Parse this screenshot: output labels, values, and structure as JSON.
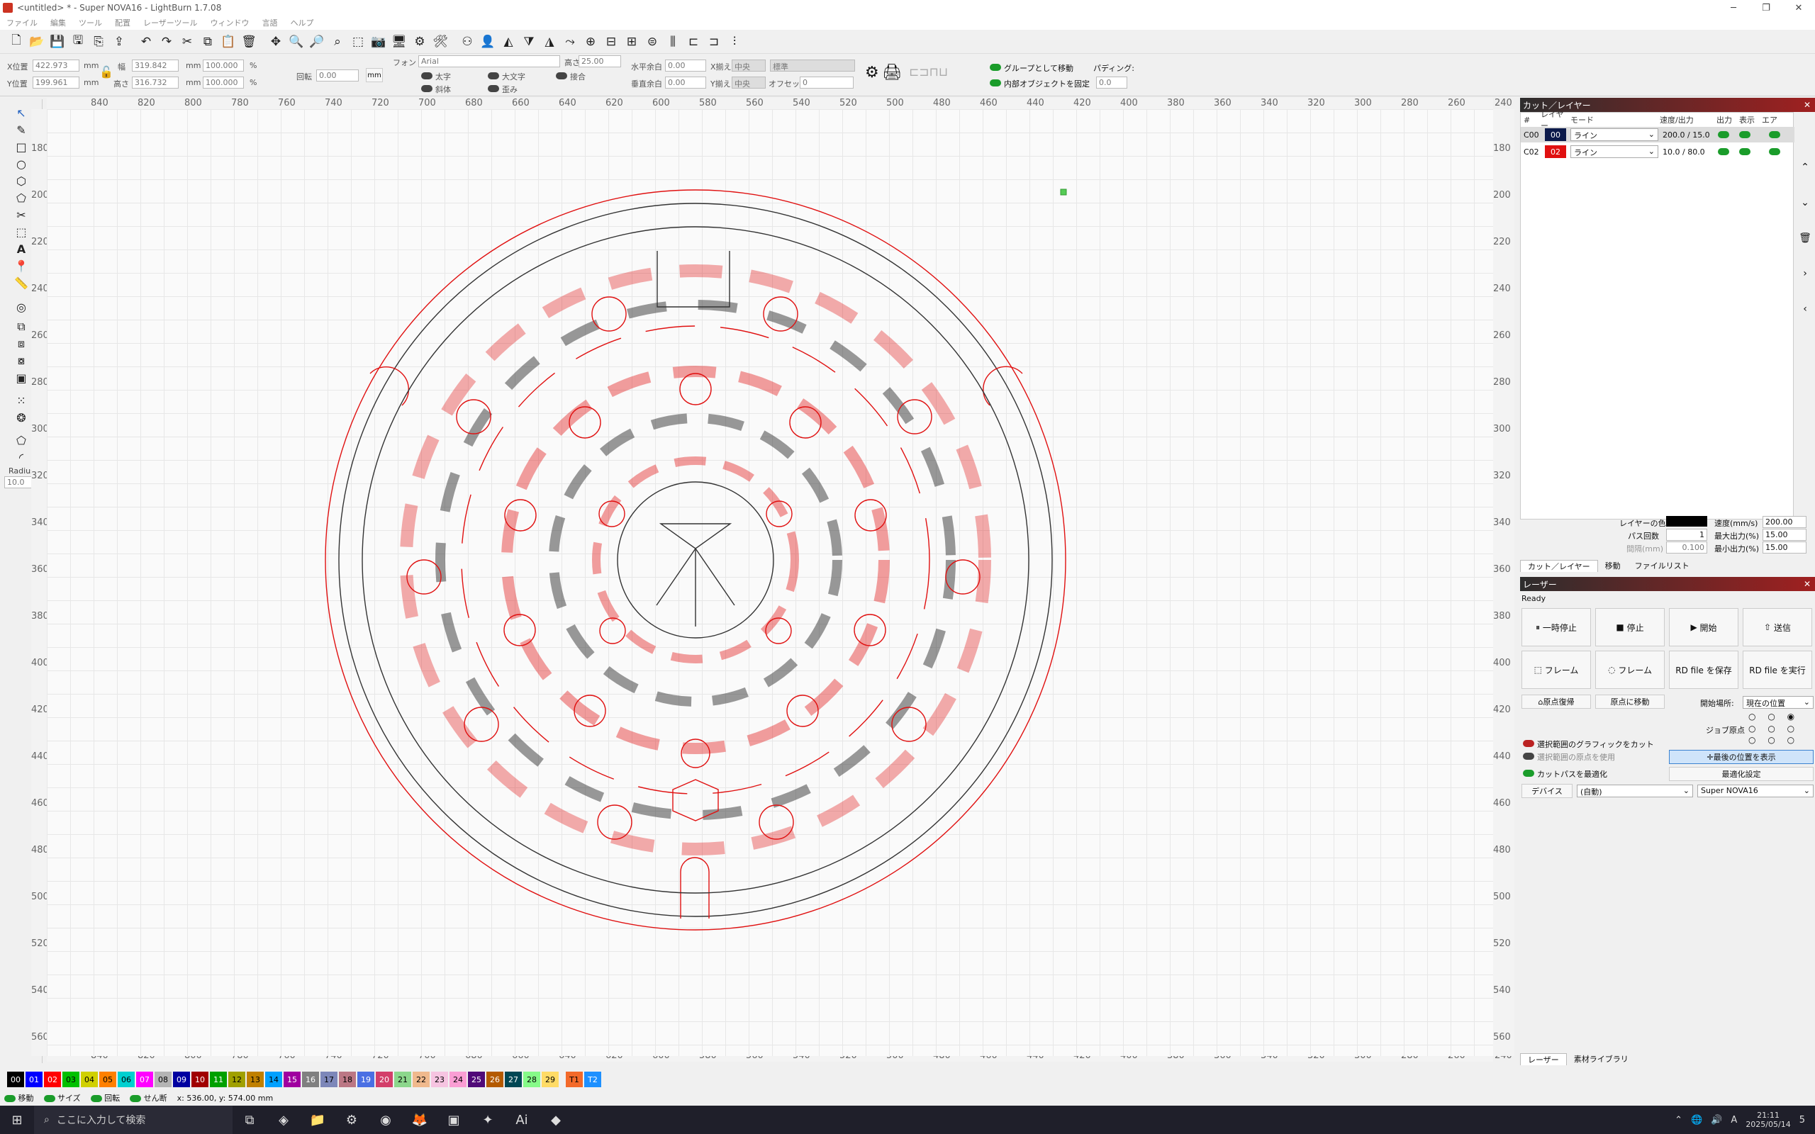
{
  "window": {
    "title": "<untitled> * - Super NOVA16 - LightBurn 1.7.08",
    "minimize": "─",
    "maximize": "❐",
    "close": "✕"
  },
  "menu": [
    "ファイル",
    "編集",
    "ツール",
    "配置",
    "レーザーツール",
    "ウィンドウ",
    "言語",
    "ヘルプ"
  ],
  "props": {
    "x_label": "X位置",
    "x_value": "422.973",
    "y_label": "Y位置",
    "y_value": "199.961",
    "w_label": "幅",
    "w_value": "319.842",
    "h_label": "高さ",
    "h_value": "316.732",
    "mm": "mm",
    "pct_w": "100.000",
    "pct_h": "100.000",
    "pct": "%",
    "rot_label": "回転",
    "rot_value": "0.00",
    "mm_btn": "mm"
  },
  "font": {
    "label": "フォント",
    "name": "Arial",
    "height_label": "高さ",
    "height": "25.00",
    "bold": "太字",
    "caps": "大文字",
    "join": "接合",
    "italic": "斜体",
    "distort": "歪み",
    "hspace_label": "水平余白",
    "hspace": "0.00",
    "vspace_label": "垂直余白",
    "vspace": "0.00",
    "xalign_label": "X揃え",
    "xalign": "中央",
    "yalign_label": "Y揃え",
    "yalign": "中央",
    "style": "標準",
    "offset_label": "オフセット",
    "offset": "0"
  },
  "group": {
    "move_as_group": "グループとして移動",
    "lock_inner": "内部オブジェクトを固定",
    "padding_label": "パディング:",
    "padding": "0.0"
  },
  "ruler": {
    "top": [
      "840",
      "820",
      "800",
      "780",
      "760",
      "740",
      "720",
      "700",
      "680",
      "660",
      "640",
      "620",
      "600",
      "580",
      "560",
      "540",
      "520",
      "500",
      "480",
      "460",
      "440",
      "420",
      "400",
      "380",
      "360",
      "340",
      "320",
      "300",
      "280",
      "260",
      "240"
    ],
    "left": [
      "180",
      "200",
      "220",
      "240",
      "260",
      "280",
      "300",
      "320",
      "340",
      "360",
      "380",
      "400",
      "420",
      "440",
      "460",
      "480",
      "500",
      "520",
      "540",
      "560"
    ]
  },
  "cut_panel": {
    "title": "カット／レイヤー",
    "headers": [
      "#",
      "レイヤー",
      "モード",
      "速度/出力",
      "出力",
      "表示",
      "エア"
    ],
    "rows": [
      {
        "id": "C00",
        "layer": "00",
        "mode": "ライン",
        "speed": "200.0 / 15.0",
        "color": "#0c1a4a"
      },
      {
        "id": "C02",
        "layer": "02",
        "mode": "ライン",
        "speed": "10.0 / 80.0",
        "color": "#e01010"
      }
    ],
    "layer_color_label": "レイヤーの色",
    "speed_label": "速度(mm/s)",
    "speed_value": "200.00",
    "pass_label": "パス回数",
    "pass_value": "1",
    "max_power_label": "最大出力(%)",
    "max_power": "15.00",
    "interval_label": "間隔(mm)",
    "interval_value": "0.100",
    "min_power_label": "最小出力(%)",
    "min_power": "15.00",
    "tabs": [
      "カット／レイヤー",
      "移動",
      "ファイルリスト"
    ]
  },
  "laser_panel": {
    "title": "レーザー",
    "status": "Ready",
    "pause": "一時停止",
    "stop": "停止",
    "start": "開始",
    "send": "送信",
    "frame1": "フレーム",
    "frame2": "フレーム",
    "save_rd": "RD file を保存",
    "run_rd": "RD file を実行",
    "home": "原点復帰",
    "goto_origin": "原点に移動",
    "start_from_label": "開始場所:",
    "start_from": "現在の位置",
    "job_origin_label": "ジョブ原点",
    "cut_selected": "選択範囲のグラフィックをカット",
    "use_selection_origin": "選択範囲の原点を使用",
    "optimize": "カットパスを最適化",
    "show_last": "最後の位置を表示",
    "optimize_settings": "最適化設定",
    "devices": "デバイス",
    "port": "(自動)",
    "device": "Super NOVA16",
    "tabs": [
      "レーザー",
      "素材ライブラリ"
    ]
  },
  "palette": [
    {
      "t": "00",
      "c": "#000000",
      "fg": "#fff"
    },
    {
      "t": "01",
      "c": "#0000ff",
      "fg": "#fff"
    },
    {
      "t": "02",
      "c": "#ff0000",
      "fg": "#fff"
    },
    {
      "t": "03",
      "c": "#00c000",
      "fg": "#000"
    },
    {
      "t": "04",
      "c": "#d0d000",
      "fg": "#000"
    },
    {
      "t": "05",
      "c": "#ff8000",
      "fg": "#000"
    },
    {
      "t": "06",
      "c": "#00d0d0",
      "fg": "#000"
    },
    {
      "t": "07",
      "c": "#ff00ff",
      "fg": "#fff"
    },
    {
      "t": "08",
      "c": "#b4b4b4",
      "fg": "#000"
    },
    {
      "t": "09",
      "c": "#0000a0",
      "fg": "#fff"
    },
    {
      "t": "10",
      "c": "#a00000",
      "fg": "#fff"
    },
    {
      "t": "11",
      "c": "#00a000",
      "fg": "#fff"
    },
    {
      "t": "12",
      "c": "#a0a000",
      "fg": "#000"
    },
    {
      "t": "13",
      "c": "#c08000",
      "fg": "#000"
    },
    {
      "t": "14",
      "c": "#00a0ff",
      "fg": "#000"
    },
    {
      "t": "15",
      "c": "#a000a0",
      "fg": "#fff"
    },
    {
      "t": "16",
      "c": "#808080",
      "fg": "#fff"
    },
    {
      "t": "17",
      "c": "#7d87b9",
      "fg": "#000"
    },
    {
      "t": "18",
      "c": "#bb7784",
      "fg": "#000"
    },
    {
      "t": "19",
      "c": "#4a6fe3",
      "fg": "#fff"
    },
    {
      "t": "20",
      "c": "#d33f6a",
      "fg": "#fff"
    },
    {
      "t": "21",
      "c": "#8cd78c",
      "fg": "#000"
    },
    {
      "t": "22",
      "c": "#f0b98d",
      "fg": "#000"
    },
    {
      "t": "23",
      "c": "#f6c4e1",
      "fg": "#000"
    },
    {
      "t": "24",
      "c": "#fa9ed4",
      "fg": "#000"
    },
    {
      "t": "25",
      "c": "#500a78",
      "fg": "#fff"
    },
    {
      "t": "26",
      "c": "#b45a00",
      "fg": "#fff"
    },
    {
      "t": "27",
      "c": "#004754",
      "fg": "#fff"
    },
    {
      "t": "28",
      "c": "#86fa88",
      "fg": "#000"
    },
    {
      "t": "29",
      "c": "#ffdb66",
      "fg": "#000"
    },
    {
      "t": "T1",
      "c": "#f36a2a",
      "fg": "#000"
    },
    {
      "t": "T2",
      "c": "#1e90ff",
      "fg": "#fff"
    }
  ],
  "status_bar": {
    "move": "移動",
    "size": "サイズ",
    "rotate": "回転",
    "shear": "せん断",
    "coords": "x: 536.00, y: 574.00 mm"
  },
  "radius": {
    "label": "Radius:",
    "value": "10.0"
  },
  "taskbar": {
    "search": "ここに入力して検索",
    "time": "21:11",
    "date": "2025/05/14",
    "lang": "A",
    "notif": "5"
  }
}
